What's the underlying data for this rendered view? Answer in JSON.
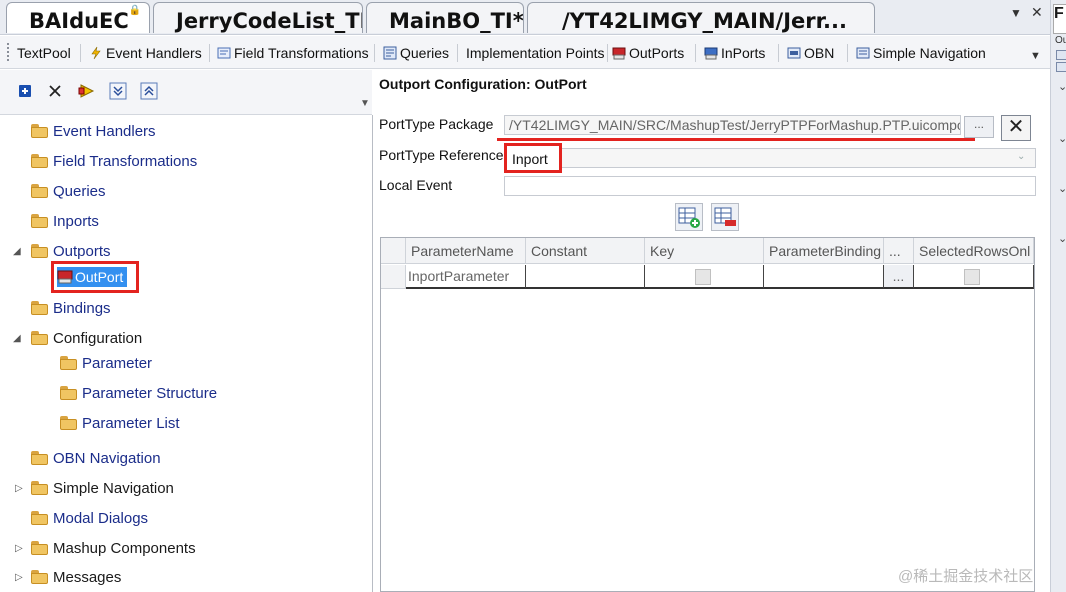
{
  "doc_tabs": [
    {
      "label": "BAIduEC",
      "locked": true,
      "active": true
    },
    {
      "label": "JerryCodeList_TI",
      "active": false
    },
    {
      "label": "MainBO_TI*",
      "active": false
    },
    {
      "label": "/YT42LIMGY_MAIN/Jerr...",
      "active": false
    }
  ],
  "right_strip": {
    "label": "Ou"
  },
  "designer_tabs": [
    {
      "label": "TextPool",
      "icon": "none"
    },
    {
      "label": "Event Handlers",
      "icon": "lightning-icon"
    },
    {
      "label": "Field Transformations",
      "icon": "field-transform-icon"
    },
    {
      "label": "Queries",
      "icon": "query-icon"
    },
    {
      "label": "Implementation Points",
      "icon": "none"
    },
    {
      "label": "OutPorts",
      "icon": "outport-icon"
    },
    {
      "label": "InPorts",
      "icon": "inport-icon"
    },
    {
      "label": "OBN",
      "icon": "obn-icon"
    },
    {
      "label": "Simple Navigation",
      "icon": "navigation-icon"
    }
  ],
  "tree": {
    "items": [
      {
        "label": "Event Handlers",
        "color": "blue"
      },
      {
        "label": "Field Transformations",
        "color": "blue"
      },
      {
        "label": "Queries",
        "color": "blue"
      },
      {
        "label": "Inports",
        "color": "blue"
      },
      {
        "label": "Outports",
        "color": "blue",
        "expanded": true
      },
      {
        "label": "OutPort",
        "selected": true
      },
      {
        "label": "Bindings",
        "color": "blue"
      },
      {
        "label": "Configuration",
        "color": "black",
        "expanded": true
      },
      {
        "label": "Parameter",
        "color": "blue"
      },
      {
        "label": "Parameter Structure",
        "color": "blue"
      },
      {
        "label": "Parameter List",
        "color": "blue"
      },
      {
        "label": "OBN Navigation",
        "color": "blue"
      },
      {
        "label": "Simple Navigation",
        "color": "black",
        "expanded": false
      },
      {
        "label": "Modal Dialogs",
        "color": "blue"
      },
      {
        "label": "Mashup Components",
        "color": "black",
        "expanded": false
      },
      {
        "label": "Messages",
        "color": "black",
        "expanded": false
      }
    ]
  },
  "config": {
    "title": "Outport Configuration: OutPort",
    "porttype_package_label": "PortType Package",
    "porttype_package_value": "/YT42LIMGY_MAIN/SRC/MashupTest/JerryPTPForMashup.PTP.uicompo",
    "browse_label": "...",
    "porttype_reference_label": "PortType Reference",
    "porttype_reference_value": "Inport",
    "local_event_label": "Local Event",
    "local_event_value": ""
  },
  "grid": {
    "columns": [
      "ParameterName",
      "Constant",
      "Key",
      "ParameterBinding",
      "...",
      "SelectedRowsOnl"
    ],
    "rows": [
      {
        "ParameterName": "InportParameter",
        "Constant": "",
        "Key": false,
        "ParameterBinding": "",
        "browse": "...",
        "SelectedRowsOnl": false
      }
    ]
  },
  "watermark": "@稀土掘金技术社区",
  "colors": {
    "highlight": "#e3231f",
    "selection": "#3390f0",
    "tree_text": "#1b2d8a"
  }
}
